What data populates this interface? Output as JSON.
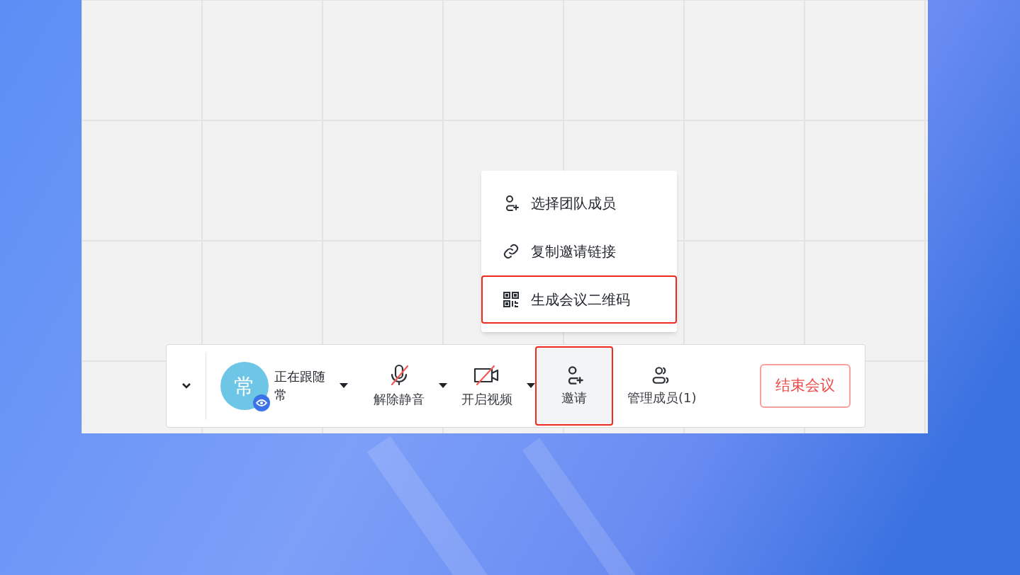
{
  "invite_menu": {
    "items": [
      {
        "kind": "select_members",
        "label": "选择团队成员",
        "highlighted": false
      },
      {
        "kind": "copy_link",
        "label": "复制邀请链接",
        "highlighted": false
      },
      {
        "kind": "qr_code",
        "label": "生成会议二维码",
        "highlighted": true
      }
    ]
  },
  "toolbar": {
    "follow": {
      "avatar_initial": "常",
      "status": "正在跟随",
      "name": "常"
    },
    "controls": [
      {
        "kind": "mic",
        "label": "解除静音",
        "muted": true,
        "dropdown": true,
        "highlighted": false
      },
      {
        "kind": "video",
        "label": "开启视频",
        "muted": true,
        "dropdown": true,
        "highlighted": false
      },
      {
        "kind": "invite",
        "label": "邀请",
        "dropdown": false,
        "highlighted": true
      },
      {
        "kind": "members",
        "label": "管理成员(1)",
        "dropdown": false,
        "highlighted": false
      }
    ],
    "end_button": "结束会议"
  }
}
